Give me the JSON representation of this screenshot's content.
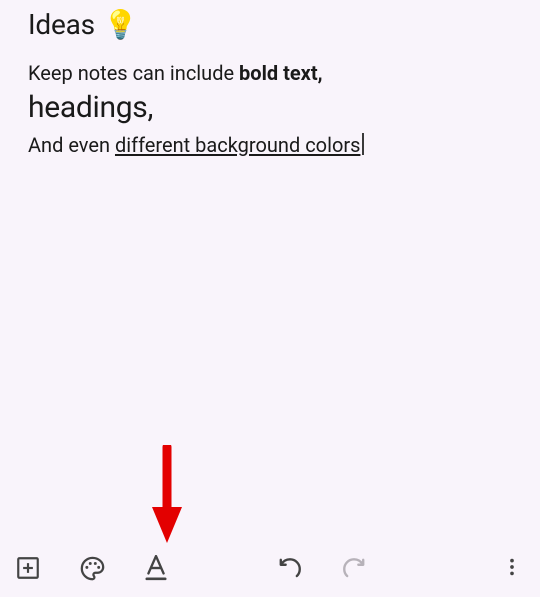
{
  "note": {
    "title_text": "Ideas",
    "title_emoji_name": "lightbulb-emoji",
    "title_emoji": "💡",
    "body": {
      "line1_prefix": "Keep notes can include ",
      "line1_bold": "bold text,",
      "line2_heading": "headings,",
      "line3_prefix": "And even ",
      "line3_underlined": "different background colors"
    }
  },
  "toolbar": {
    "add_label": "Add",
    "palette_label": "Background options",
    "format_label": "Text formatting",
    "undo_label": "Undo",
    "redo_label": "Redo",
    "overflow_label": "More options"
  },
  "annotation": {
    "description": "Red arrow pointing down at text-format button"
  },
  "colors": {
    "background": "#f9f4fb",
    "toolbar_icon": "#444444",
    "toolbar_icon_disabled": "#b7b2b9",
    "arrow": "#e30000"
  }
}
